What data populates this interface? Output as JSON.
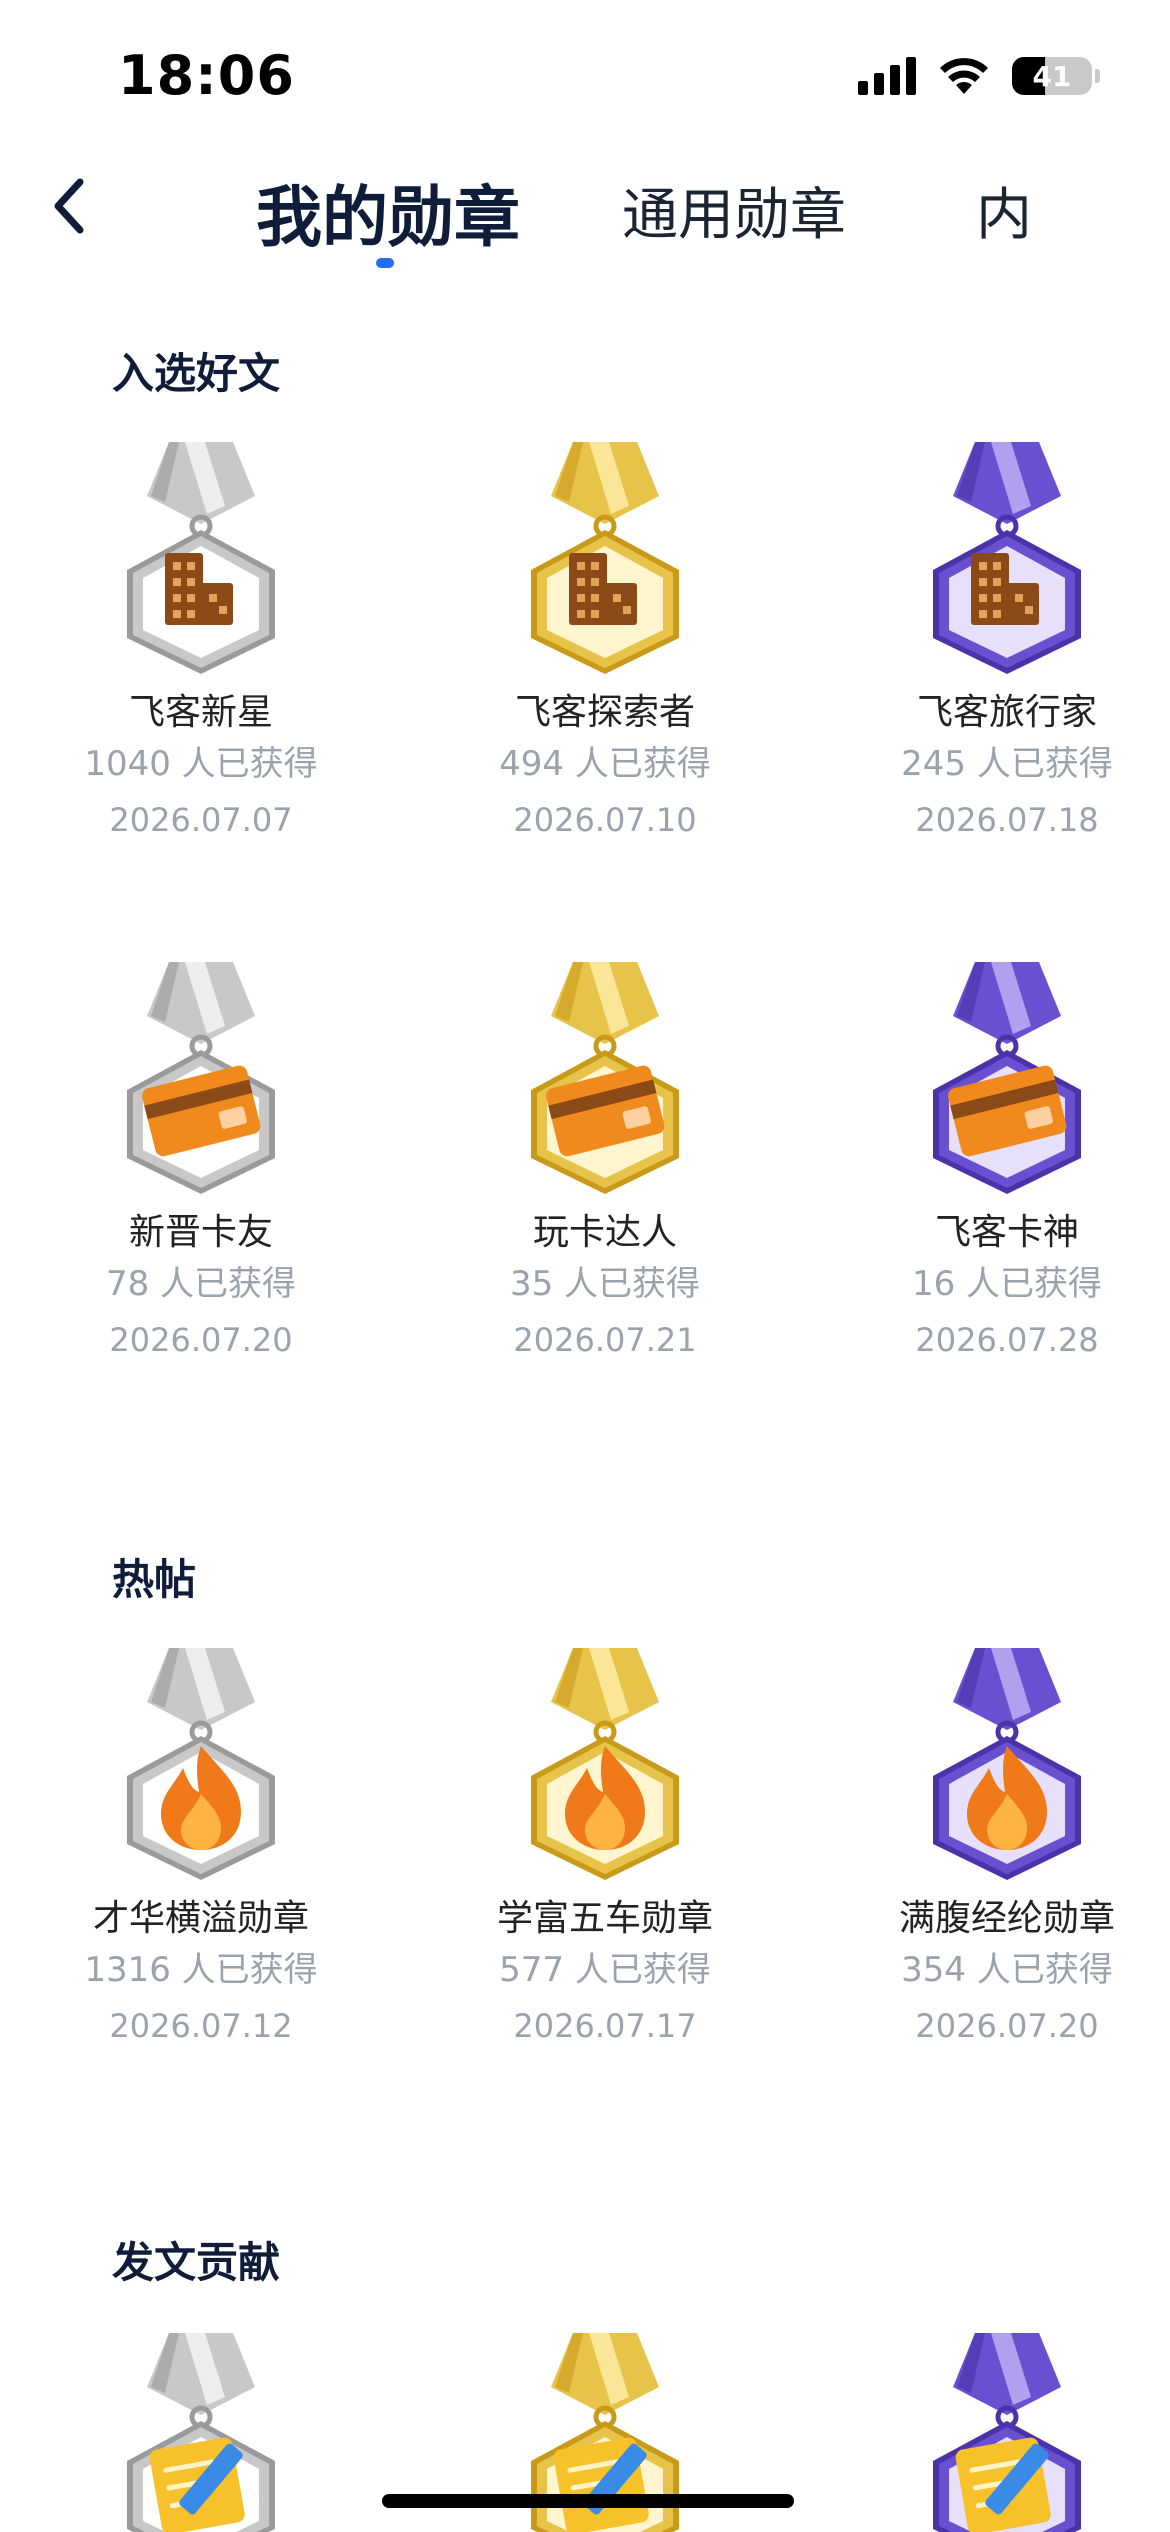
{
  "status_bar": {
    "time": "18:06",
    "battery": "41",
    "battery_level": 0.41,
    "icons": [
      "signal-icon",
      "wifi-icon",
      "battery-icon"
    ]
  },
  "nav": {
    "back_icon": "chevron-left-icon",
    "tabs": [
      {
        "label": "我的勋章",
        "active": true
      },
      {
        "label": "通用勋章",
        "active": false
      },
      {
        "label": "内",
        "active": false
      }
    ],
    "accent_color": "#1f6ff2"
  },
  "tiers": {
    "silver": "#c8c8c8",
    "gold": "#e8c34a",
    "purple": "#6a4fd0"
  },
  "sections": [
    {
      "title": "入选好文",
      "badges": [
        {
          "name": "飞客新星",
          "count": "1040 人已获得",
          "date": "2026.07.07",
          "tier": "silver",
          "icon": "building-icon"
        },
        {
          "name": "飞客探索者",
          "count": "494 人已获得",
          "date": "2026.07.10",
          "tier": "gold",
          "icon": "building-icon"
        },
        {
          "name": "飞客旅行家",
          "count": "245 人已获得",
          "date": "2026.07.18",
          "tier": "purple",
          "icon": "building-icon"
        },
        {
          "name": "新晋卡友",
          "count": "78 人已获得",
          "date": "2026.07.20",
          "tier": "silver",
          "icon": "credit-card-icon"
        },
        {
          "name": "玩卡达人",
          "count": "35 人已获得",
          "date": "2026.07.21",
          "tier": "gold",
          "icon": "credit-card-icon"
        },
        {
          "name": "飞客卡神",
          "count": "16 人已获得",
          "date": "2026.07.28",
          "tier": "purple",
          "icon": "credit-card-icon"
        }
      ]
    },
    {
      "title": "热帖",
      "badges": [
        {
          "name": "才华横溢勋章",
          "count": "1316 人已获得",
          "date": "2026.07.12",
          "tier": "silver",
          "icon": "flame-icon"
        },
        {
          "name": "学富五车勋章",
          "count": "577 人已获得",
          "date": "2026.07.17",
          "tier": "gold",
          "icon": "flame-icon"
        },
        {
          "name": "满腹经纶勋章",
          "count": "354 人已获得",
          "date": "2026.07.20",
          "tier": "purple",
          "icon": "flame-icon"
        }
      ]
    },
    {
      "title": "发文贡献",
      "badges": [
        {
          "name": "",
          "count": "",
          "date": "",
          "tier": "silver",
          "icon": "pencil-note-icon"
        },
        {
          "name": "",
          "count": "",
          "date": "",
          "tier": "gold",
          "icon": "pencil-note-icon"
        },
        {
          "name": "",
          "count": "",
          "date": "",
          "tier": "purple",
          "icon": "pencil-note-icon"
        }
      ]
    }
  ]
}
